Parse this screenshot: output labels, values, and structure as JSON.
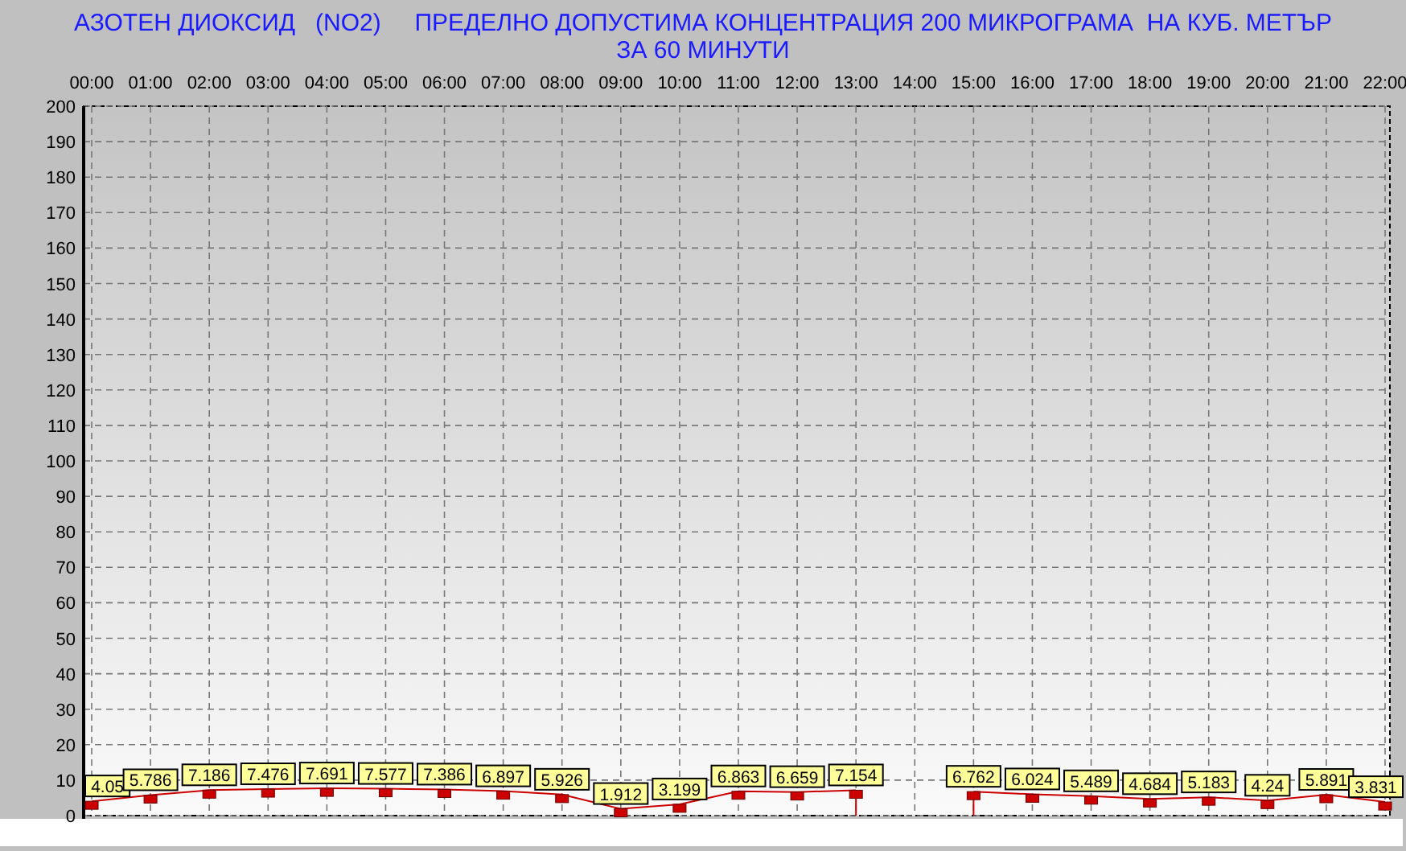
{
  "chart_data": {
    "type": "line",
    "title": "АЗОТЕН ДИОКСИД   (NO2)     ПРЕДЕЛНО ДОПУСТИМА КОНЦЕНТРАЦИЯ 200 МИКРОГРАМА  НА КУБ. МЕТЪР\nЗА 60 МИНУТИ",
    "categories": [
      "00:00",
      "01:00",
      "02:00",
      "03:00",
      "04:00",
      "05:00",
      "06:00",
      "07:00",
      "08:00",
      "09:00",
      "10:00",
      "11:00",
      "12:00",
      "13:00",
      "14:00",
      "15:00",
      "16:00",
      "17:00",
      "18:00",
      "19:00",
      "20:00",
      "21:00",
      "22:00"
    ],
    "series": [
      {
        "color": "#cc0000",
        "values": [
          4.05,
          5.786,
          7.186,
          7.476,
          7.691,
          7.577,
          7.386,
          6.897,
          5.926,
          1.912,
          3.199,
          6.863,
          6.659,
          7.154,
          null,
          6.762,
          6.024,
          5.489,
          4.684,
          5.183,
          4.24,
          5.891,
          3.831
        ]
      }
    ],
    "ylim": [
      0,
      200
    ],
    "yticks": [
      0,
      10,
      20,
      30,
      40,
      50,
      60,
      70,
      80,
      90,
      100,
      110,
      120,
      130,
      140,
      150,
      160,
      170,
      180,
      190,
      200
    ],
    "grid": true,
    "data_labels": true,
    "value_labels": [
      "4.05",
      "5.786",
      "7.186",
      "7.476",
      "7.691",
      "7.577",
      "7.386",
      "6.897",
      "5.926",
      "1.912",
      "3.199",
      "6.863",
      "6.659",
      "7.154",
      null,
      "6.762",
      "6.024",
      "5.489",
      "4.684",
      "5.183",
      "4.24",
      "5.891",
      "3.831"
    ]
  }
}
